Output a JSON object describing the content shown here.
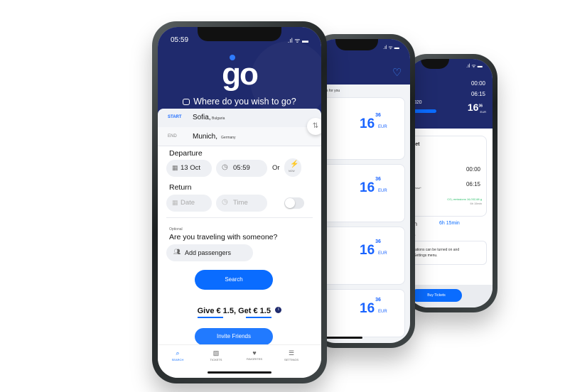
{
  "main": {
    "time": "05:59",
    "status": ".ıl ᯤ ▬",
    "logo": "go",
    "headline": "Where do you wish to go?",
    "start": {
      "tag": "START",
      "city": "Sofia,",
      "country": "Bulgaria"
    },
    "end": {
      "tag": "END",
      "city": "Munich,",
      "country": "Germany"
    },
    "departure": {
      "label": "Departure",
      "date": "13 Oct",
      "time": "05:59",
      "or": "Or",
      "now": "NOW"
    },
    "return": {
      "label": "Return",
      "date": "Date",
      "time": "Time"
    },
    "optional": "Optional",
    "question": "Are you traveling with someone?",
    "add_passengers": "Add passengers",
    "search": "Search",
    "promo": "Give € 1.5, Get € 1.5",
    "invite": "Invite Friends",
    "tabs": [
      {
        "icon": "search-icon",
        "label": "SEARCH"
      },
      {
        "icon": "ticket-icon",
        "label": "TICKETS"
      },
      {
        "icon": "heart-icon",
        "label": "FAVORITES"
      },
      {
        "icon": "settings-icon",
        "label": "SETTINGS"
      }
    ]
  },
  "results": {
    "subtitle": "us rides for you",
    "cards": [
      {
        "price": "16",
        "cents": "36",
        "cur": "EUR",
        "small": "g"
      },
      {
        "price": "16",
        "cents": "36",
        "cur": "EUR",
        "small": "g g"
      },
      {
        "price": "16",
        "cents": "36",
        "cur": "EUR",
        "small": "g g"
      },
      {
        "price": "16",
        "cents": "36",
        "cur": "EUR",
        "small": "g g"
      }
    ]
  },
  "details": {
    "time1": "00:00",
    "time2": "06:15",
    "date": "2020",
    "small1": "ng",
    "price": "16",
    "cents": "36",
    "cur": "EUR",
    "met": "met",
    "dep_time": "00:00",
    "arr_time": "06:15",
    "express": "ss",
    "express2": "rpressz*",
    "co2": "CO₂ emissions 16,032,68 g",
    "co2sub": "6h 15min",
    "duration_label": "on",
    "duration": "6h 15min",
    "ons": "ons",
    "notice1": "ifications can be turned on and",
    "notice2": "e Settings menu.",
    "buy": "Buy Tickets"
  }
}
